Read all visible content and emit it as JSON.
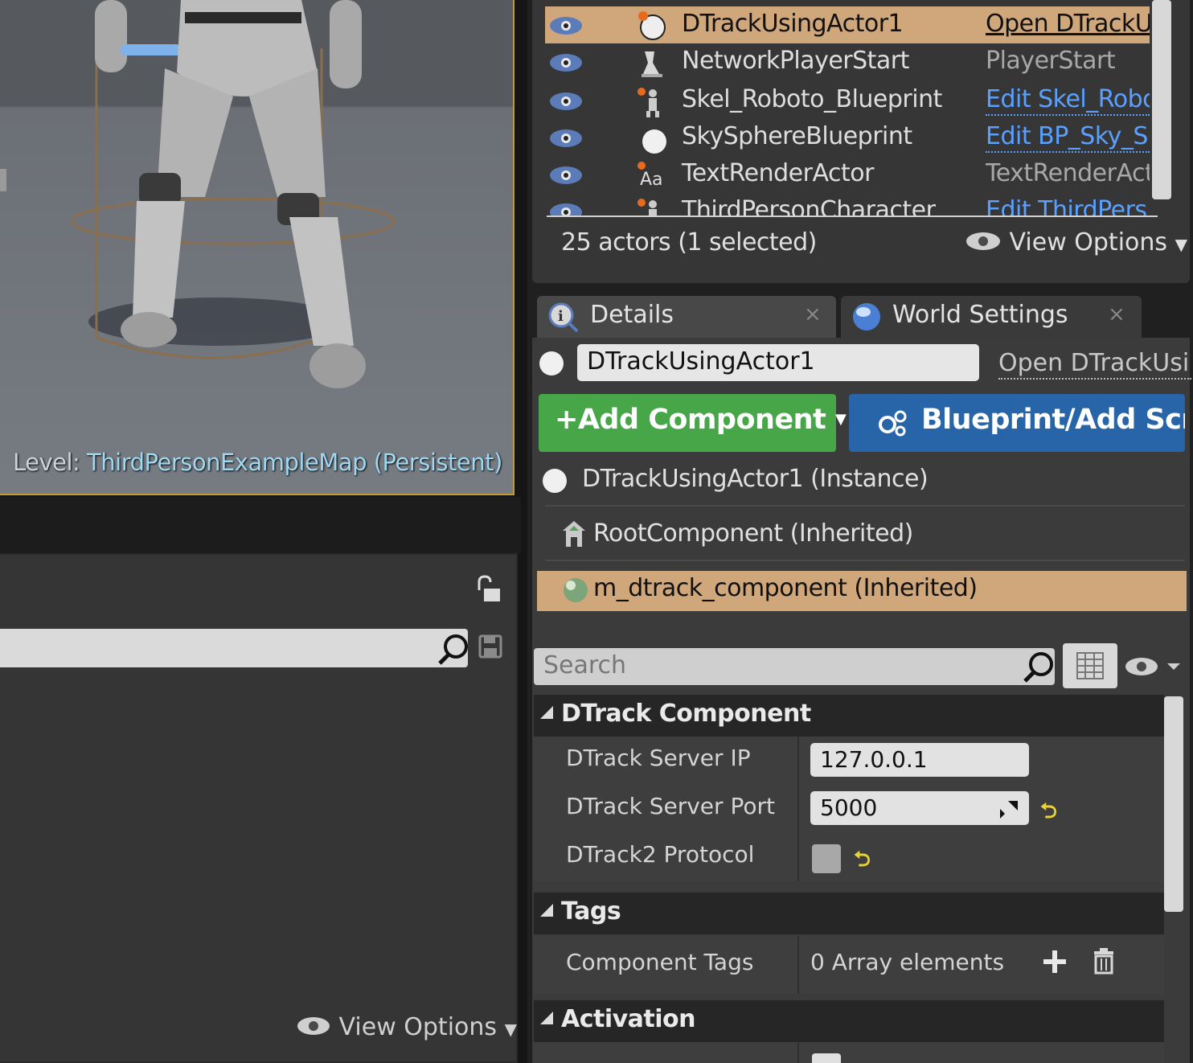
{
  "viewport": {
    "level_label": "Level:",
    "level_name": "ThirdPersonExampleMap (Persistent)"
  },
  "outliner": {
    "rows": [
      {
        "label": "DTrackUsingActor1",
        "type": "Open DTrackU",
        "selected": true,
        "icon": "sphere-actor-icon"
      },
      {
        "label": "NetworkPlayerStart",
        "type": "PlayerStart",
        "icon": "player-start-icon"
      },
      {
        "label": "Skel_Roboto_Blueprint",
        "type": "Edit Skel_Robo",
        "icon": "skeleton-icon"
      },
      {
        "label": "SkySphereBlueprint",
        "type": "Edit BP_Sky_S",
        "icon": "sphere-icon"
      },
      {
        "label": "TextRenderActor",
        "type": "TextRenderActo",
        "icon": "text-render-icon"
      },
      {
        "label": "ThirdPersonCharacter",
        "type": "Edit ThirdPers",
        "icon": "character-icon"
      }
    ],
    "actor_count": "25 actors (1 selected)",
    "view_options": "View Options"
  },
  "tabs": [
    {
      "label": "Details",
      "close": "×"
    },
    {
      "label": "World Settings",
      "close": "×"
    }
  ],
  "details": {
    "actor_name": "DTrackUsingActor1",
    "open_link": "Open DTrackUsi",
    "add_component": "Add Component",
    "add_component_prefix": "+",
    "blueprint_button": "Blueprint/Add Scr",
    "components": [
      {
        "label": "DTrackUsingActor1 (Instance)"
      },
      {
        "label": "RootComponent (Inherited)"
      },
      {
        "label": "m_dtrack_component (Inherited)",
        "selected": true
      }
    ],
    "search_placeholder": "Search",
    "categories": {
      "dtrack": "DTrack Component",
      "tags": "Tags",
      "activation": "Activation"
    },
    "props": {
      "server_ip_label": "DTrack Server IP",
      "server_ip_value": "127.0.0.1",
      "server_port_label": "DTrack Server Port",
      "server_port_value": "5000",
      "protocol_label": "DTrack2 Protocol",
      "component_tags_label": "Component Tags",
      "component_tags_value": "0 Array elements"
    }
  },
  "left_panel": {
    "view_options": "View Options"
  },
  "colors": {
    "selection": "#d0a77a",
    "add_button": "#47a647",
    "blueprint_button": "#2765a8",
    "link": "#5aa0ff",
    "viewport_border": "#c59a32",
    "reset_arrow": "#e8d23a"
  }
}
